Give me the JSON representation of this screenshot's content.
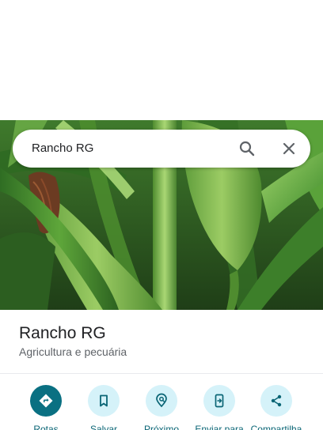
{
  "search": {
    "query": "Rancho RG",
    "search_icon": "search-icon",
    "close_icon": "close-icon"
  },
  "photo": {
    "subject": "corn-plants"
  },
  "place": {
    "title": "Rancho RG",
    "category": "Agricultura e pecuária"
  },
  "actions": [
    {
      "label": "Rotas",
      "icon": "directions-icon"
    },
    {
      "label": "Salvar",
      "icon": "bookmark-icon"
    },
    {
      "label": "Próximo",
      "icon": "nearby-icon"
    },
    {
      "label": "Enviar para",
      "icon": "send-to-phone-icon"
    },
    {
      "label": "Compartilha",
      "icon": "share-icon"
    }
  ],
  "colors": {
    "accent": "#0a7082",
    "accent_light": "#d5f2f9",
    "text_primary": "#202124",
    "text_secondary": "#5f6368"
  }
}
